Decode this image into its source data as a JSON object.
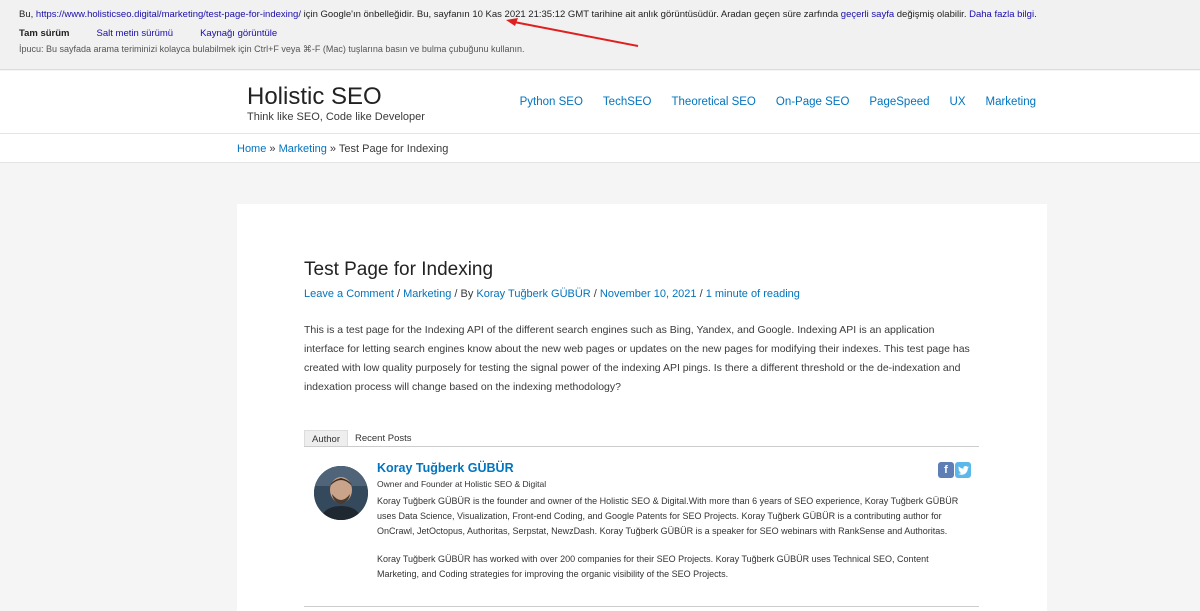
{
  "cache_banner": {
    "prefix": "Bu, ",
    "url": "https://www.holisticseo.digital/marketing/test-page-for-indexing/",
    "middle": " için Google'ın önbelleğidir. Bu, sayfanın 10 Kas 2021 21:35:12 GMT tarihine ait anlık görüntüsüdür. Aradan geçen süre zarfında ",
    "current_page_link": "geçerli sayfa",
    "after_link": " değişmiş olabilir. ",
    "more_info_link": "Daha fazla bilgi.",
    "tabs": [
      "Tam sürüm",
      "Salt metin sürümü",
      "Kaynağı görüntüle"
    ],
    "tip": "İpucu: Bu sayfada arama teriminizi kolayca bulabilmek için Ctrl+F veya ⌘-F (Mac) tuşlarına basın ve bulma çubuğunu kullanın."
  },
  "header": {
    "site_title": "Holistic SEO",
    "tagline": "Think like SEO, Code like Developer",
    "nav": [
      "Python SEO",
      "TechSEO",
      "Theoretical SEO",
      "On-Page SEO",
      "PageSpeed",
      "UX",
      "Marketing"
    ]
  },
  "breadcrumb": {
    "home": "Home",
    "sep1": " » ",
    "section": "Marketing",
    "sep2": " » ",
    "current": "Test Page for Indexing"
  },
  "post": {
    "title": "Test Page for Indexing",
    "meta_comment": "Leave a Comment",
    "meta_sep1": " / ",
    "meta_category": "Marketing",
    "meta_sep2": " / By ",
    "meta_author": "Koray Tuğberk GÜBÜR",
    "meta_sep3": " / ",
    "meta_date": "November 10, 2021",
    "meta_sep4": " / ",
    "meta_reading": "1 minute of reading",
    "body": "This is a test page for the Indexing API of the different search engines such as Bing, Yandex, and Google. Indexing API is an application interface for letting search engines know about the new web pages or updates on the new pages for modifying their indexes. This test page has created with low quality purposely for testing the signal power of the indexing API pings. Is there a different threshold or the de-indexation and indexation process will change based on the indexing methodology?"
  },
  "author_box": {
    "tabs": [
      "Author",
      "Recent Posts"
    ],
    "name": "Koray Tuğberk GÜBÜR",
    "role": "Owner and Founder at Holistic SEO & Digital",
    "bio_1": "Koray Tuğberk GÜBÜR is the founder and owner of the Holistic SEO & Digital.With more than 6 years of SEO experience, Koray Tuğberk GÜBÜR uses Data Science, Visualization, Front-end Coding, and Google Patents for SEO Projects. Koray Tuğberk GÜBÜR is a contributing author for OnCrawl, JetOctopus, Authoritas, Serpstat, NewzDash. Koray Tuğberk GÜBÜR is a speaker for SEO webinars with RankSense and Authoritas.",
    "bio_2": "Koray Tuğberk GÜBÜR has worked with over 200 companies for their SEO Projects. Koray Tuğberk GÜBÜR uses Technical SEO, Content Marketing, and Coding strategies for improving the organic visibility of the SEO Projects.",
    "facebook_glyph": "f",
    "twitter_icon": "twitter-icon"
  },
  "colors": {
    "link": "#0274be",
    "cache_link": "#1a0dab",
    "annotation_arrow": "#e0201f"
  }
}
